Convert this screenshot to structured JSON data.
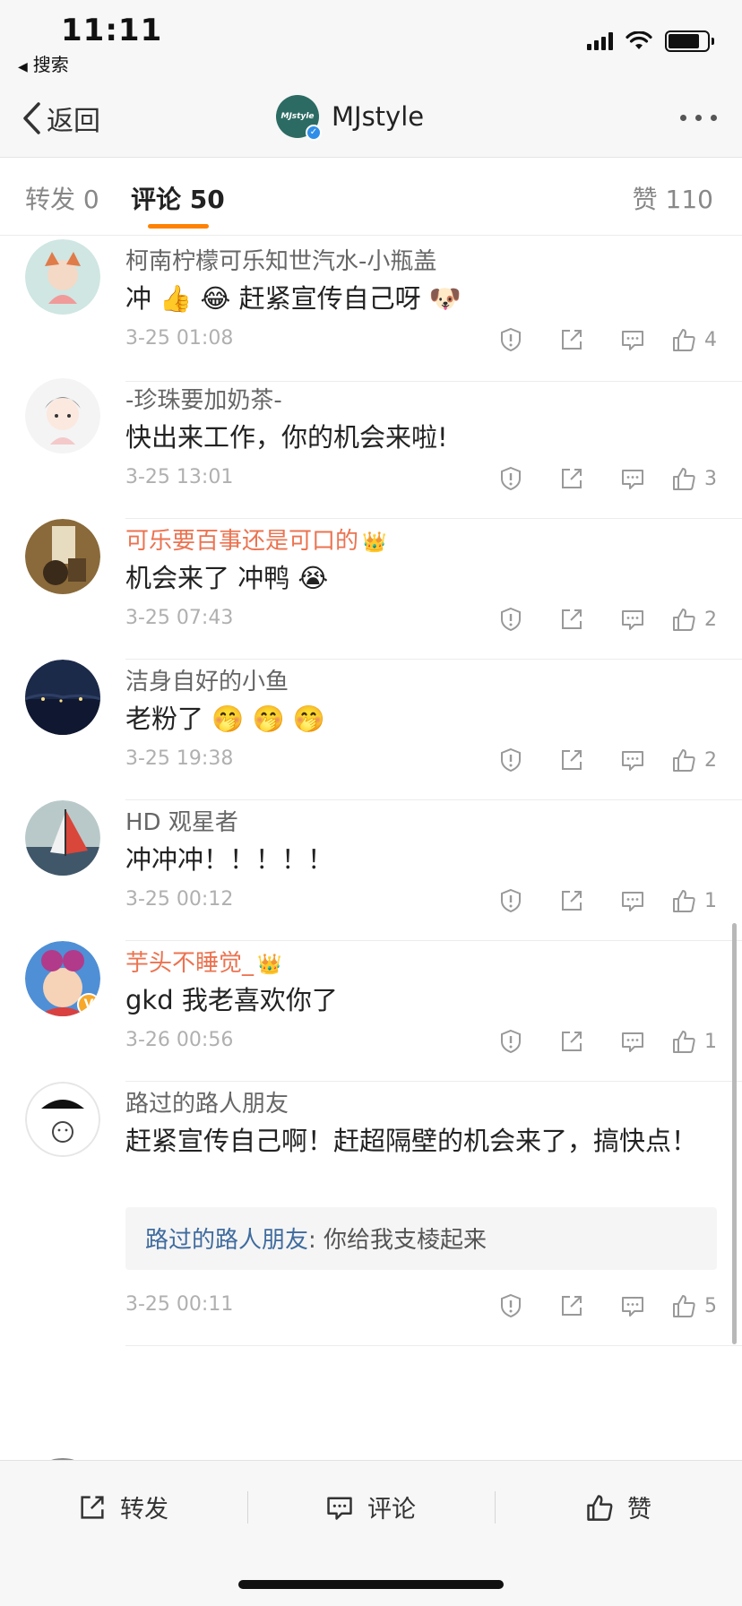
{
  "status_bar": {
    "time": "11:11",
    "back_app": "搜索",
    "battery_level": 0.8
  },
  "nav": {
    "back_label": "返回",
    "brand_avatar_text": "MJstyle",
    "title": "MJstyle"
  },
  "tabs": {
    "repost": "转发 0",
    "comment": "评论 50",
    "like": "赞 110"
  },
  "comments": [
    {
      "name": "柯南柠檬可乐知世汽水-小瓶盖",
      "text": "冲 👍 😂 赶紧宣传自己呀 🐶",
      "time": "3-25 01:08",
      "likes": "4",
      "vip": false
    },
    {
      "name": "-珍珠要加奶茶-",
      "text": "快出来工作，你的机会来啦!",
      "time": "3-25 13:01",
      "likes": "3",
      "vip": false
    },
    {
      "name": "可乐要百事还是可口的",
      "badge": "👑",
      "text": "机会来了 冲鸭 😭",
      "time": "3-25 07:43",
      "likes": "2",
      "vip": true
    },
    {
      "name": "洁身自好的小鱼",
      "text": "老粉了 🤭 🤭 🤭",
      "time": "3-25 19:38",
      "likes": "2",
      "vip": false
    },
    {
      "name": "HD 观星者",
      "text": "冲冲冲！！！！！",
      "time": "3-25 00:12",
      "likes": "1",
      "vip": false
    },
    {
      "name": "芋头不睡觉_",
      "badge": "👑",
      "text": "gkd 我老喜欢你了",
      "time": "3-26 00:56",
      "likes": "1",
      "vip": true
    },
    {
      "name": "路过的路人朋友",
      "text": "赶紧宣传自己啊！赶超隔壁的机会来了，搞快点！",
      "time": "3-25 00:11",
      "likes": "5",
      "vip": false,
      "reply": {
        "name": "路过的路人朋友",
        "text": ": 你给我支棱起来"
      }
    }
  ],
  "bottom_bar": {
    "repost": "转发",
    "comment": "评论",
    "like": "赞"
  },
  "colors": {
    "accent": "#ff8200",
    "vip_name": "#eb7350",
    "reply_name": "#3f6b9e",
    "verified_blue": "#2f8ee8",
    "verified_gold": "#f7a829"
  },
  "icons": [
    "report-icon",
    "share-icon",
    "reply-icon",
    "like-icon"
  ]
}
